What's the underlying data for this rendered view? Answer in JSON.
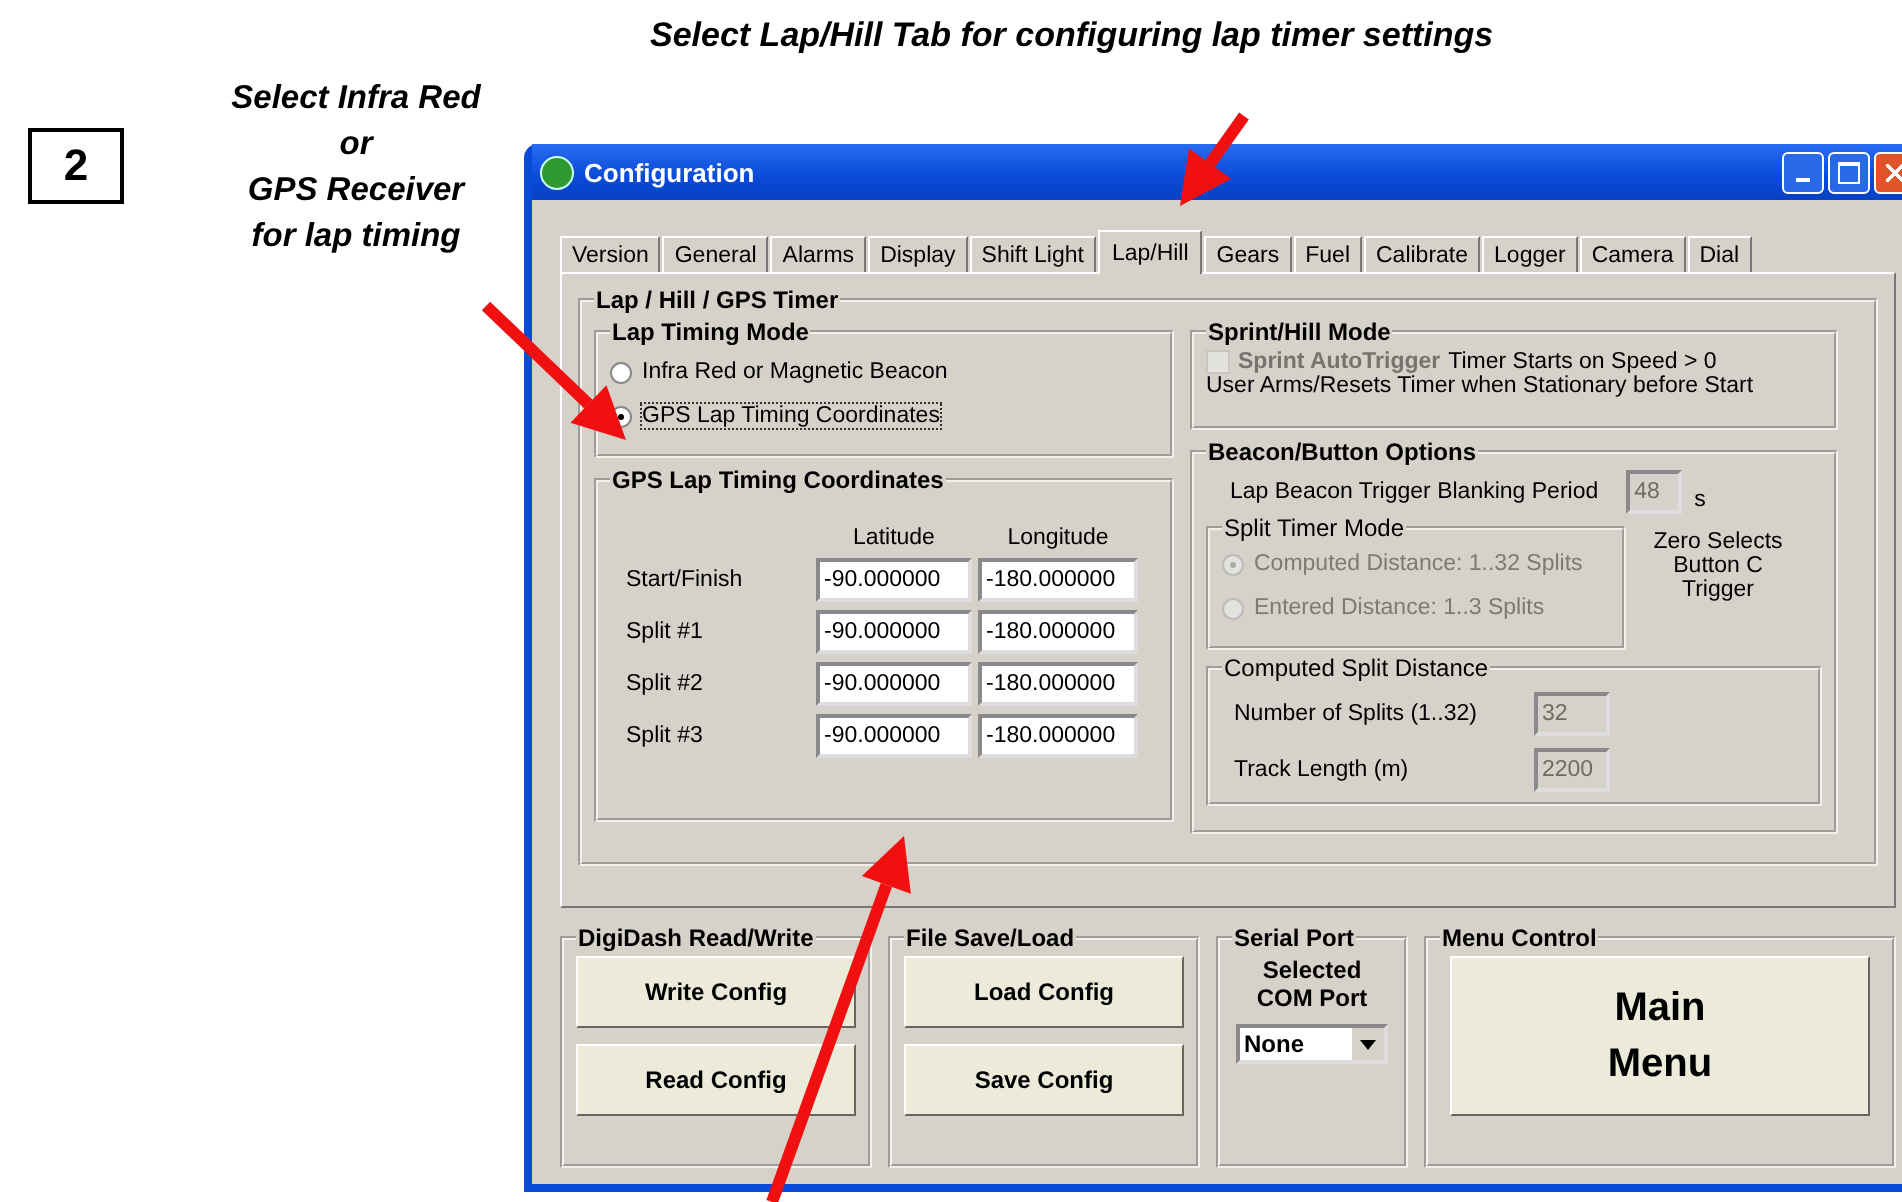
{
  "annotations": {
    "step_number": "2",
    "top_callout": "Select Lap/Hill Tab for configuring lap timer settings",
    "left_callout": [
      "Select Infra Red",
      "or",
      "GPS Receiver",
      "for lap timing"
    ]
  },
  "window": {
    "title": "Configuration",
    "tabs": [
      {
        "label": "Version",
        "selected": false
      },
      {
        "label": "General",
        "selected": false
      },
      {
        "label": "Alarms",
        "selected": false
      },
      {
        "label": "Display",
        "selected": false
      },
      {
        "label": "Shift Light",
        "selected": false
      },
      {
        "label": "Lap/Hill",
        "selected": true
      },
      {
        "label": "Gears",
        "selected": false
      },
      {
        "label": "Fuel",
        "selected": false
      },
      {
        "label": "Calibrate",
        "selected": false
      },
      {
        "label": "Logger",
        "selected": false
      },
      {
        "label": "Camera",
        "selected": false
      },
      {
        "label": "Dial",
        "selected": false
      }
    ],
    "timer_group": {
      "title": "Lap / Hill / GPS Timer",
      "lap_timing_mode": {
        "title": "Lap Timing Mode",
        "options": [
          {
            "label": "Infra Red or Magnetic Beacon",
            "selected": false
          },
          {
            "label": "GPS Lap Timing Coordinates",
            "selected": true
          }
        ]
      },
      "gps_coordinates": {
        "title": "GPS Lap Timing Coordinates",
        "columns": [
          "Latitude",
          "Longitude"
        ],
        "rows": [
          {
            "label": "Start/Finish",
            "latitude": "-90.000000",
            "longitude": "-180.000000"
          },
          {
            "label": "Split #1",
            "latitude": "-90.000000",
            "longitude": "-180.000000"
          },
          {
            "label": "Split #2",
            "latitude": "-90.000000",
            "longitude": "-180.000000"
          },
          {
            "label": "Split #3",
            "latitude": "-90.000000",
            "longitude": "-180.000000"
          }
        ]
      },
      "sprint_hill": {
        "title": "Sprint/Hill Mode",
        "checkbox": {
          "label": "Sprint AutoTrigger",
          "checked": false,
          "disabled": true
        },
        "note": "Timer Starts on Speed > 0",
        "note_2": "User Arms/Resets Timer when Stationary before Start"
      },
      "beacon_options": {
        "title": "Beacon/Button Options",
        "blanking_label": "Lap Beacon Trigger Blanking Period",
        "blanking_value": "48",
        "blanking_disabled": true,
        "unit": "s",
        "split_timer_mode": {
          "title": "Split Timer Mode",
          "disabled": true,
          "options": [
            {
              "label": "Computed Distance: 1..32 Splits",
              "selected": true
            },
            {
              "label": "Entered Distance: 1..3 Splits",
              "selected": false
            }
          ]
        },
        "zero_note": "Zero Selects Button C Trigger",
        "computed_split": {
          "title": "Computed Split Distance",
          "fields": [
            {
              "label": "Number of Splits (1..32)",
              "value": "32",
              "disabled": true
            },
            {
              "label": "Track Length (m)",
              "value": "2200",
              "disabled": true
            }
          ]
        }
      }
    },
    "bottom_groups": [
      {
        "kind": "buttons",
        "title": "DigiDash Read/Write",
        "buttons": [
          "Write Config",
          "Read Config"
        ]
      },
      {
        "kind": "buttons",
        "title": "File Save/Load",
        "buttons": [
          "Load Config",
          "Save Config"
        ]
      },
      {
        "kind": "port",
        "title": "Serial Port",
        "label": "Selected COM Port",
        "value": "None"
      },
      {
        "kind": "menu",
        "title": "Menu Control",
        "button": "Main Menu"
      }
    ]
  }
}
